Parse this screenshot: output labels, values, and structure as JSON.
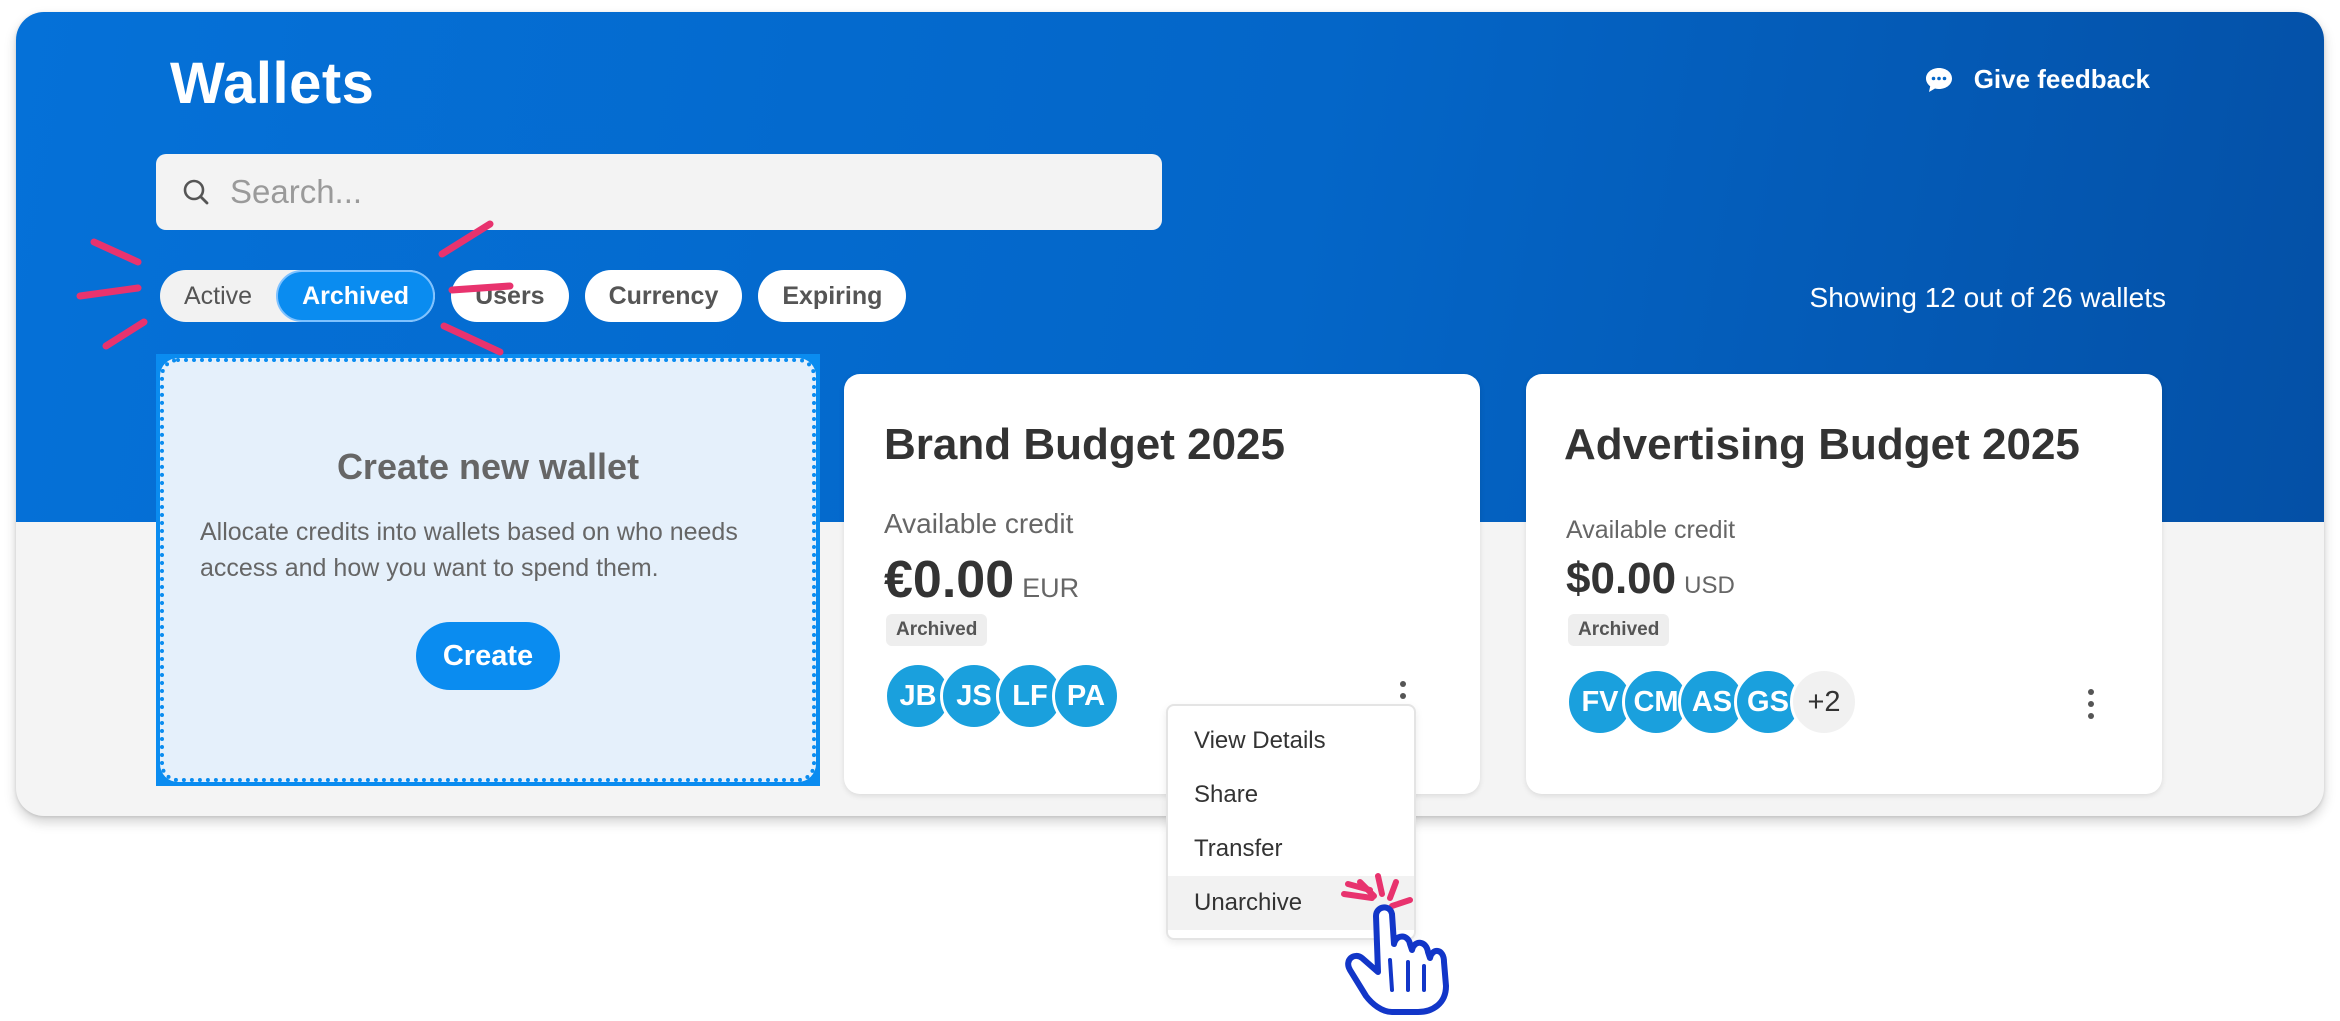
{
  "header": {
    "title": "Wallets",
    "feedback_label": "Give feedback",
    "feedback_icon": "speech-bubble-icon"
  },
  "search": {
    "placeholder": "Search...",
    "value": ""
  },
  "filters": {
    "toggle": [
      {
        "label": "Active",
        "selected": false
      },
      {
        "label": "Archived",
        "selected": true
      }
    ],
    "chips": [
      "Users",
      "Currency",
      "Expiring"
    ]
  },
  "summary": "Showing 12 out of 26 wallets",
  "create_card": {
    "title": "Create new wallet",
    "description": "Allocate credits into wallets based on who needs access and how you want to spend them.",
    "button": "Create"
  },
  "wallets": [
    {
      "name": "Brand Budget 2025",
      "credit_label": "Available credit",
      "amount": "€0.00",
      "currency": "EUR",
      "status": "Archived",
      "users": [
        "JB",
        "JS",
        "LF",
        "PA"
      ],
      "more": ""
    },
    {
      "name": "Advertising Budget 2025",
      "credit_label": "Available credit",
      "amount": "$0.00",
      "currency": "USD",
      "status": "Archived",
      "users": [
        "FV",
        "CM",
        "AS",
        "GS"
      ],
      "more": "+2"
    }
  ],
  "context_menu": {
    "items": [
      "View Details",
      "Share",
      "Transfer",
      "Unarchive"
    ],
    "highlighted": "Unarchive"
  },
  "colors": {
    "brand_blue": "#0a8cf0",
    "hero_gradient_start": "#0571d8",
    "hero_gradient_end": "#0450a6",
    "avatar": "#1aa0dd",
    "highlight_marks": "#e8336e",
    "pointer_outline": "#1236c8"
  }
}
